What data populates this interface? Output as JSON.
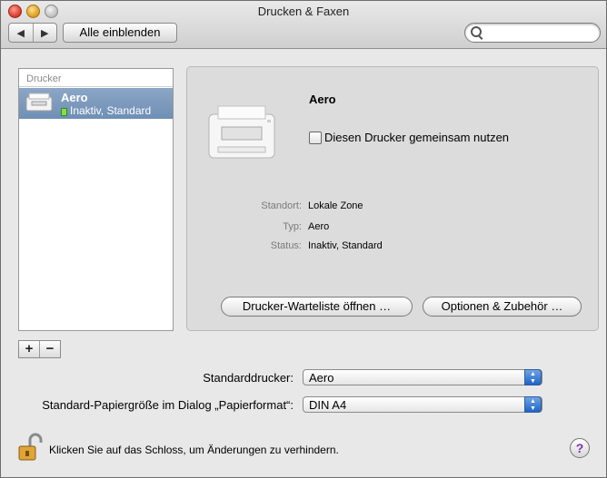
{
  "window": {
    "title": "Drucken & Faxen"
  },
  "toolbar": {
    "back_label": "◀",
    "forward_label": "▶",
    "show_all_label": "Alle einblenden",
    "search_value": "",
    "search_placeholder": ""
  },
  "sidebar": {
    "header": "Drucker",
    "items": [
      {
        "name": "Aero",
        "status": "Inaktiv, Standard",
        "selected": true
      }
    ],
    "add_label": "+",
    "remove_label": "−"
  },
  "detail": {
    "name": "Aero",
    "share_label": "Diesen Drucker gemeinsam nutzen",
    "share_checked": false,
    "info": [
      {
        "label": "Standort:",
        "value": "Lokale Zone"
      },
      {
        "label": "Typ:",
        "value": "Aero"
      },
      {
        "label": "Status:",
        "value": "Inaktiv, Standard"
      }
    ],
    "queue_button": "Drucker-Warteliste öffnen …",
    "options_button": "Optionen & Zubehör …"
  },
  "defaults": {
    "printer_label": "Standarddrucker:",
    "printer_value": "Aero",
    "paper_label": "Standard-Papiergröße im Dialog „Papierformat“:",
    "paper_value": "DIN A4"
  },
  "footer": {
    "lock_text": "Klicken Sie auf das Schloss, um Änderungen zu verhindern.",
    "help_label": "?"
  },
  "colors": {
    "selection": "#7695bc",
    "select_arrows": "#2f6fd0",
    "status_dot": "#7ee04a"
  }
}
